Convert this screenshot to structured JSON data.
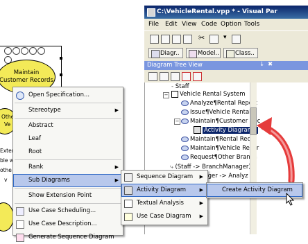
{
  "window": {
    "title": "C:\\VehicleRental.vpp * - Visual Par",
    "menus": [
      "File",
      "Edit",
      "View",
      "Code",
      "Option",
      "Tools"
    ],
    "view_tabs": [
      "Diagr..",
      "Model..",
      "Class.."
    ]
  },
  "tree_panel": {
    "title": "Diagram Tree View",
    "pin": "↓",
    "close": "✖",
    "rows": [
      {
        "label": "Staff"
      },
      {
        "label": "Vehicle Rental System"
      },
      {
        "label": "Analyze¶Rental Report"
      },
      {
        "label": "Issue¶Vehicle Rental"
      },
      {
        "label": "Maintain¶Customer Rec"
      },
      {
        "label": "Activity Diagram1"
      },
      {
        "label": "Maintain¶Rental Recor"
      },
      {
        "label": "Maintain¶Vehicle Recor"
      },
      {
        "label": "Request¶Other Branch"
      },
      {
        "label": "(Staff -> BranchManager)"
      },
      {
        "label": "nager -> Analyz"
      }
    ]
  },
  "background_diagram": {
    "use_case_1": "Maintain\nCustomer Records",
    "frag_1": "Othe",
    "frag_2": "Ve",
    "frag_3": "Exten",
    "frag_4": "ble w",
    "frag_5": "othe",
    "frag_6": "v"
  },
  "context_menu": {
    "items": [
      {
        "label": "Open Specification...",
        "icon": "spec-icon"
      },
      {
        "label": "Stereotype",
        "submenu": true
      },
      {
        "label": "Abstract"
      },
      {
        "label": "Leaf"
      },
      {
        "label": "Root"
      },
      {
        "label": "Rank",
        "submenu": true
      },
      {
        "label": "Sub Diagrams",
        "submenu": true,
        "highlighted": true
      },
      {
        "label": "Show Extension Point"
      },
      {
        "label": "Use Case Scheduling...",
        "icon": "schedule-icon"
      },
      {
        "label": "Use Case Description...",
        "icon": "description-icon"
      },
      {
        "label": "Generate Sequence Diagram",
        "icon": "generate-icon"
      }
    ]
  },
  "sub_diagrams_menu": {
    "items": [
      {
        "label": "Sequence Diagram",
        "submenu": true
      },
      {
        "label": "Activity Diagram",
        "submenu": true,
        "highlighted": true
      },
      {
        "label": "Textual Analysis",
        "submenu": true
      },
      {
        "label": "Use Case Diagram",
        "submenu": true
      }
    ]
  },
  "activity_menu": {
    "items": [
      {
        "label": "Create Activity Diagram",
        "highlighted": true
      }
    ]
  },
  "colors": {
    "use_case_fill": "#f3ea58",
    "title_bar": "#0a246a",
    "highlight": "#b8c8ec",
    "annotation_arrow": "#e53b3b"
  }
}
